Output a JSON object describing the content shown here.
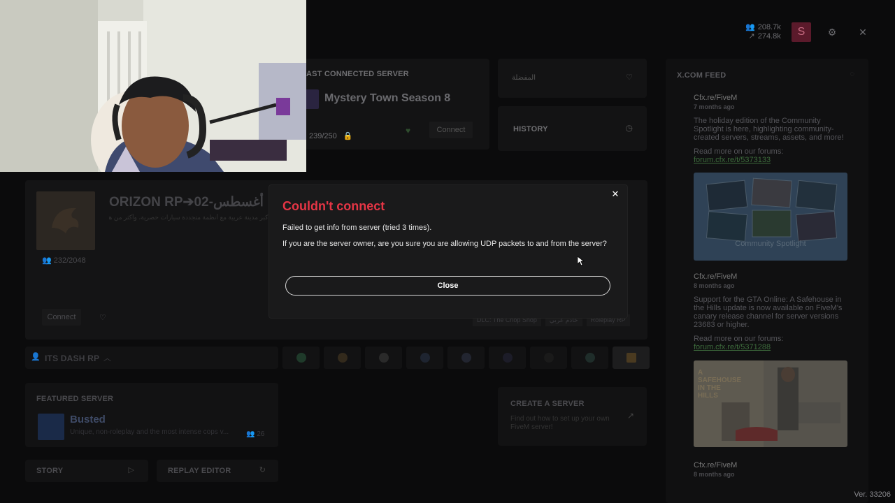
{
  "header": {
    "players_online": "208.7k",
    "servers_count": "274.8k",
    "user_initial": "S"
  },
  "last_connected": {
    "heading": "AST CONNECTED SERVER",
    "server_name": "Mystery Town Season 8",
    "players": "239/250",
    "connect_label": "Connect"
  },
  "favorites": {
    "label": "المفضلة"
  },
  "history": {
    "label": "HISTORY"
  },
  "orizon_card": {
    "name": "ORIZON RP➔أغسطس-02",
    "description": "أكبر مدينة عربية مع أنظمة متجددة سيارات حصرية، وأكثر من هيك مافيا",
    "players": "232/2048",
    "connect_label": "Connect",
    "tags": [
      "DLC: The Chop Shop",
      "خادم عربي",
      "Roleplay RP"
    ]
  },
  "dash_bar": {
    "label": "ITS DASH RP"
  },
  "featured": {
    "heading": "FEATURED SERVER",
    "name": "Busted",
    "description": "Unique, non-roleplay and the most intense cops v...",
    "players": "26"
  },
  "create_server": {
    "heading": "CREATE A SERVER",
    "description": "Find out how to set up your own FiveM server!"
  },
  "story": {
    "label": "STORY"
  },
  "replay": {
    "label": "REPLAY EDITOR"
  },
  "feed": {
    "heading": "X.COM FEED",
    "items": [
      {
        "account": "Cfx.re/FiveM",
        "ago": "7 months ago",
        "body": "The holiday edition of the Community Spotlight is here, highlighting community-created servers, streams, assets, and more!",
        "read_more": "Read more on our forums:",
        "link": "forum.cfx.re/t/5373133",
        "image_caption": "Community Spotlight"
      },
      {
        "account": "Cfx.re/FiveM",
        "ago": "8 months ago",
        "body": "Support for the GTA Online: A Safehouse in the Hills update is now available on FiveM's canary release channel for server versions 23683 or higher.",
        "read_more": "Read more on our forums:",
        "link": "forum.cfx.re/t/5371288",
        "image_caption": "A SAFEHOUSE IN THE HILLS"
      },
      {
        "account": "Cfx.re/FiveM",
        "ago": "8 months ago"
      }
    ]
  },
  "version": "Ver. 33206",
  "modal": {
    "title": "Couldn't connect",
    "message_1": "Failed to get info from server (tried 3 times).",
    "message_2": "If you are the server owner, are you sure you are allowing UDP packets to and from the server?",
    "close_label": "Close"
  },
  "colors": {
    "error_title": "#e53545",
    "accent_green": "#3d6b3c",
    "user_badge": "#5b1a2b"
  }
}
